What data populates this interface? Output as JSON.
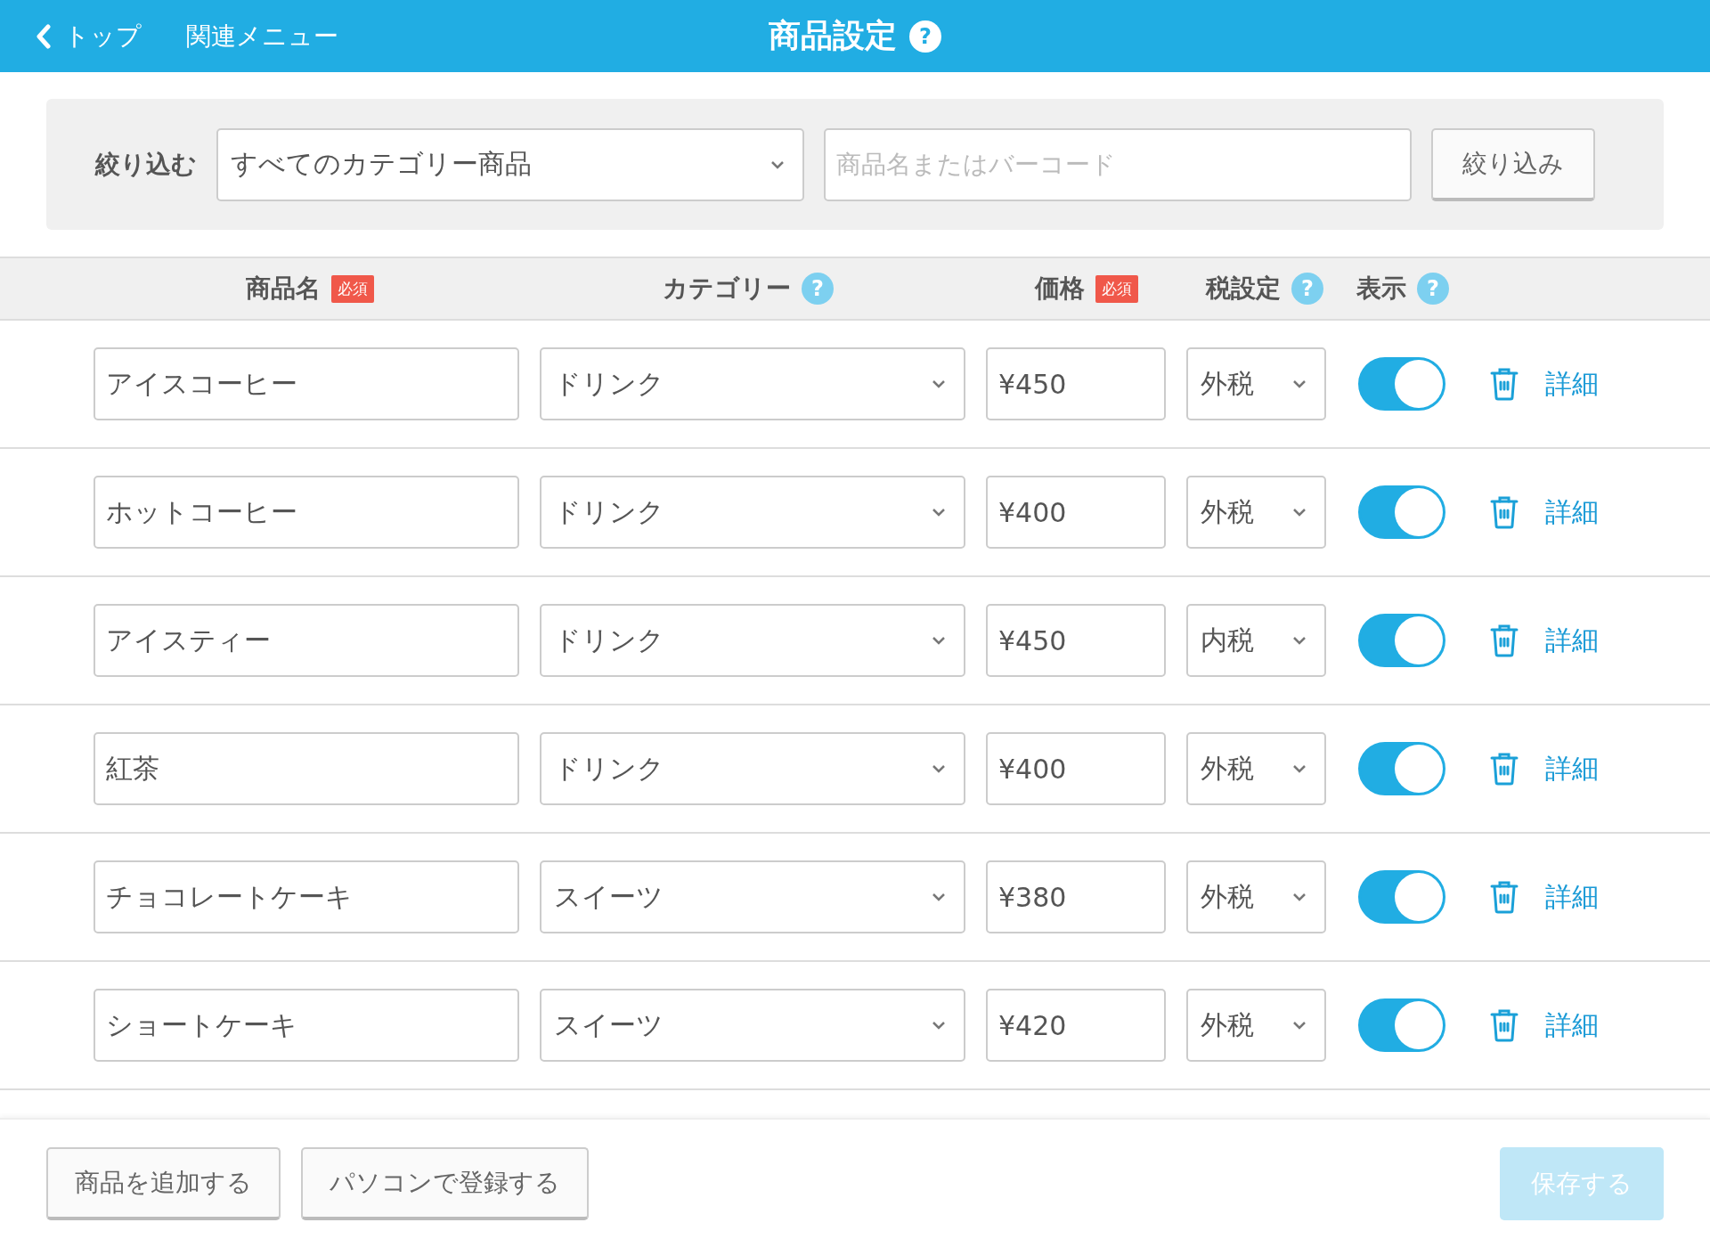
{
  "header": {
    "back_label": "トップ",
    "menu_label": "関連メニュー",
    "title": "商品設定",
    "help": "?"
  },
  "filter": {
    "label": "絞り込む",
    "category": "すべてのカテゴリー商品",
    "search_placeholder": "商品名またはバーコード",
    "button": "絞り込み"
  },
  "columns": [
    {
      "label": "商品名",
      "required": "必須"
    },
    {
      "label": "カテゴリー",
      "help": "?"
    },
    {
      "label": "価格",
      "required": "必須"
    },
    {
      "label": "税設定",
      "help": "?"
    },
    {
      "label": "表示",
      "help": "?"
    }
  ],
  "rows": [
    {
      "name": "アイスコーヒー",
      "category": "ドリンク",
      "price": "¥450",
      "tax": "外税",
      "visible": true,
      "detail": "詳細"
    },
    {
      "name": "ホットコーヒー",
      "category": "ドリンク",
      "price": "¥400",
      "tax": "外税",
      "visible": true,
      "detail": "詳細"
    },
    {
      "name": "アイスティー",
      "category": "ドリンク",
      "price": "¥450",
      "tax": "内税",
      "visible": true,
      "detail": "詳細"
    },
    {
      "name": "紅茶",
      "category": "ドリンク",
      "price": "¥400",
      "tax": "外税",
      "visible": true,
      "detail": "詳細"
    },
    {
      "name": "チョコレートケーキ",
      "category": "スイーツ",
      "price": "¥380",
      "tax": "外税",
      "visible": true,
      "detail": "詳細"
    },
    {
      "name": "ショートケーキ",
      "category": "スイーツ",
      "price": "¥420",
      "tax": "外税",
      "visible": true,
      "detail": "詳細"
    }
  ],
  "footer": {
    "buttons": [
      "商品を追加する",
      "パソコンで登録する"
    ],
    "save": {
      "label": "保存する",
      "disabled": true
    }
  }
}
